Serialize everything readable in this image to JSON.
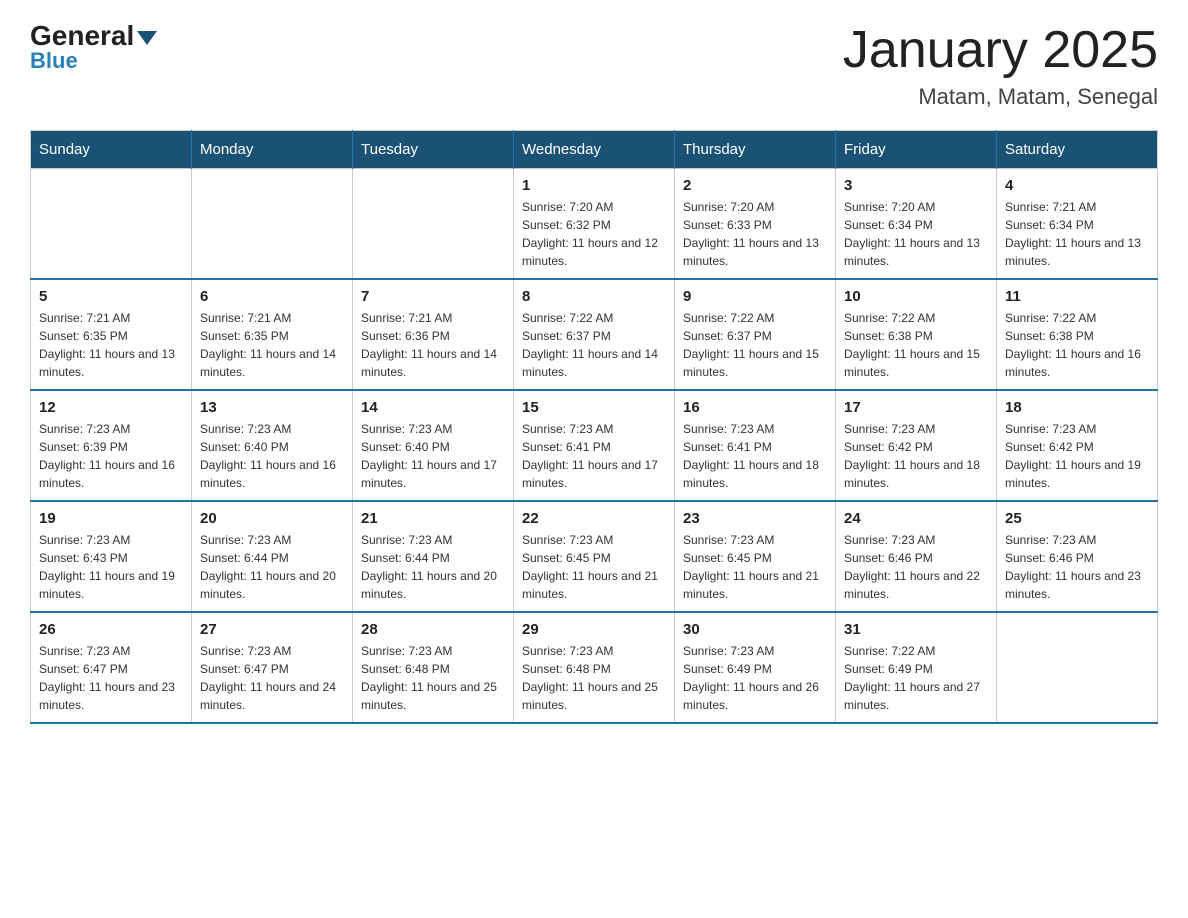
{
  "logo": {
    "general_text": "General",
    "blue_text": "Blue"
  },
  "title": "January 2025",
  "subtitle": "Matam, Matam, Senegal",
  "days_of_week": [
    "Sunday",
    "Monday",
    "Tuesday",
    "Wednesday",
    "Thursday",
    "Friday",
    "Saturday"
  ],
  "weeks": [
    [
      {
        "day": "",
        "info": ""
      },
      {
        "day": "",
        "info": ""
      },
      {
        "day": "",
        "info": ""
      },
      {
        "day": "1",
        "info": "Sunrise: 7:20 AM\nSunset: 6:32 PM\nDaylight: 11 hours and 12 minutes."
      },
      {
        "day": "2",
        "info": "Sunrise: 7:20 AM\nSunset: 6:33 PM\nDaylight: 11 hours and 13 minutes."
      },
      {
        "day": "3",
        "info": "Sunrise: 7:20 AM\nSunset: 6:34 PM\nDaylight: 11 hours and 13 minutes."
      },
      {
        "day": "4",
        "info": "Sunrise: 7:21 AM\nSunset: 6:34 PM\nDaylight: 11 hours and 13 minutes."
      }
    ],
    [
      {
        "day": "5",
        "info": "Sunrise: 7:21 AM\nSunset: 6:35 PM\nDaylight: 11 hours and 13 minutes."
      },
      {
        "day": "6",
        "info": "Sunrise: 7:21 AM\nSunset: 6:35 PM\nDaylight: 11 hours and 14 minutes."
      },
      {
        "day": "7",
        "info": "Sunrise: 7:21 AM\nSunset: 6:36 PM\nDaylight: 11 hours and 14 minutes."
      },
      {
        "day": "8",
        "info": "Sunrise: 7:22 AM\nSunset: 6:37 PM\nDaylight: 11 hours and 14 minutes."
      },
      {
        "day": "9",
        "info": "Sunrise: 7:22 AM\nSunset: 6:37 PM\nDaylight: 11 hours and 15 minutes."
      },
      {
        "day": "10",
        "info": "Sunrise: 7:22 AM\nSunset: 6:38 PM\nDaylight: 11 hours and 15 minutes."
      },
      {
        "day": "11",
        "info": "Sunrise: 7:22 AM\nSunset: 6:38 PM\nDaylight: 11 hours and 16 minutes."
      }
    ],
    [
      {
        "day": "12",
        "info": "Sunrise: 7:23 AM\nSunset: 6:39 PM\nDaylight: 11 hours and 16 minutes."
      },
      {
        "day": "13",
        "info": "Sunrise: 7:23 AM\nSunset: 6:40 PM\nDaylight: 11 hours and 16 minutes."
      },
      {
        "day": "14",
        "info": "Sunrise: 7:23 AM\nSunset: 6:40 PM\nDaylight: 11 hours and 17 minutes."
      },
      {
        "day": "15",
        "info": "Sunrise: 7:23 AM\nSunset: 6:41 PM\nDaylight: 11 hours and 17 minutes."
      },
      {
        "day": "16",
        "info": "Sunrise: 7:23 AM\nSunset: 6:41 PM\nDaylight: 11 hours and 18 minutes."
      },
      {
        "day": "17",
        "info": "Sunrise: 7:23 AM\nSunset: 6:42 PM\nDaylight: 11 hours and 18 minutes."
      },
      {
        "day": "18",
        "info": "Sunrise: 7:23 AM\nSunset: 6:42 PM\nDaylight: 11 hours and 19 minutes."
      }
    ],
    [
      {
        "day": "19",
        "info": "Sunrise: 7:23 AM\nSunset: 6:43 PM\nDaylight: 11 hours and 19 minutes."
      },
      {
        "day": "20",
        "info": "Sunrise: 7:23 AM\nSunset: 6:44 PM\nDaylight: 11 hours and 20 minutes."
      },
      {
        "day": "21",
        "info": "Sunrise: 7:23 AM\nSunset: 6:44 PM\nDaylight: 11 hours and 20 minutes."
      },
      {
        "day": "22",
        "info": "Sunrise: 7:23 AM\nSunset: 6:45 PM\nDaylight: 11 hours and 21 minutes."
      },
      {
        "day": "23",
        "info": "Sunrise: 7:23 AM\nSunset: 6:45 PM\nDaylight: 11 hours and 21 minutes."
      },
      {
        "day": "24",
        "info": "Sunrise: 7:23 AM\nSunset: 6:46 PM\nDaylight: 11 hours and 22 minutes."
      },
      {
        "day": "25",
        "info": "Sunrise: 7:23 AM\nSunset: 6:46 PM\nDaylight: 11 hours and 23 minutes."
      }
    ],
    [
      {
        "day": "26",
        "info": "Sunrise: 7:23 AM\nSunset: 6:47 PM\nDaylight: 11 hours and 23 minutes."
      },
      {
        "day": "27",
        "info": "Sunrise: 7:23 AM\nSunset: 6:47 PM\nDaylight: 11 hours and 24 minutes."
      },
      {
        "day": "28",
        "info": "Sunrise: 7:23 AM\nSunset: 6:48 PM\nDaylight: 11 hours and 25 minutes."
      },
      {
        "day": "29",
        "info": "Sunrise: 7:23 AM\nSunset: 6:48 PM\nDaylight: 11 hours and 25 minutes."
      },
      {
        "day": "30",
        "info": "Sunrise: 7:23 AM\nSunset: 6:49 PM\nDaylight: 11 hours and 26 minutes."
      },
      {
        "day": "31",
        "info": "Sunrise: 7:22 AM\nSunset: 6:49 PM\nDaylight: 11 hours and 27 minutes."
      },
      {
        "day": "",
        "info": ""
      }
    ]
  ]
}
